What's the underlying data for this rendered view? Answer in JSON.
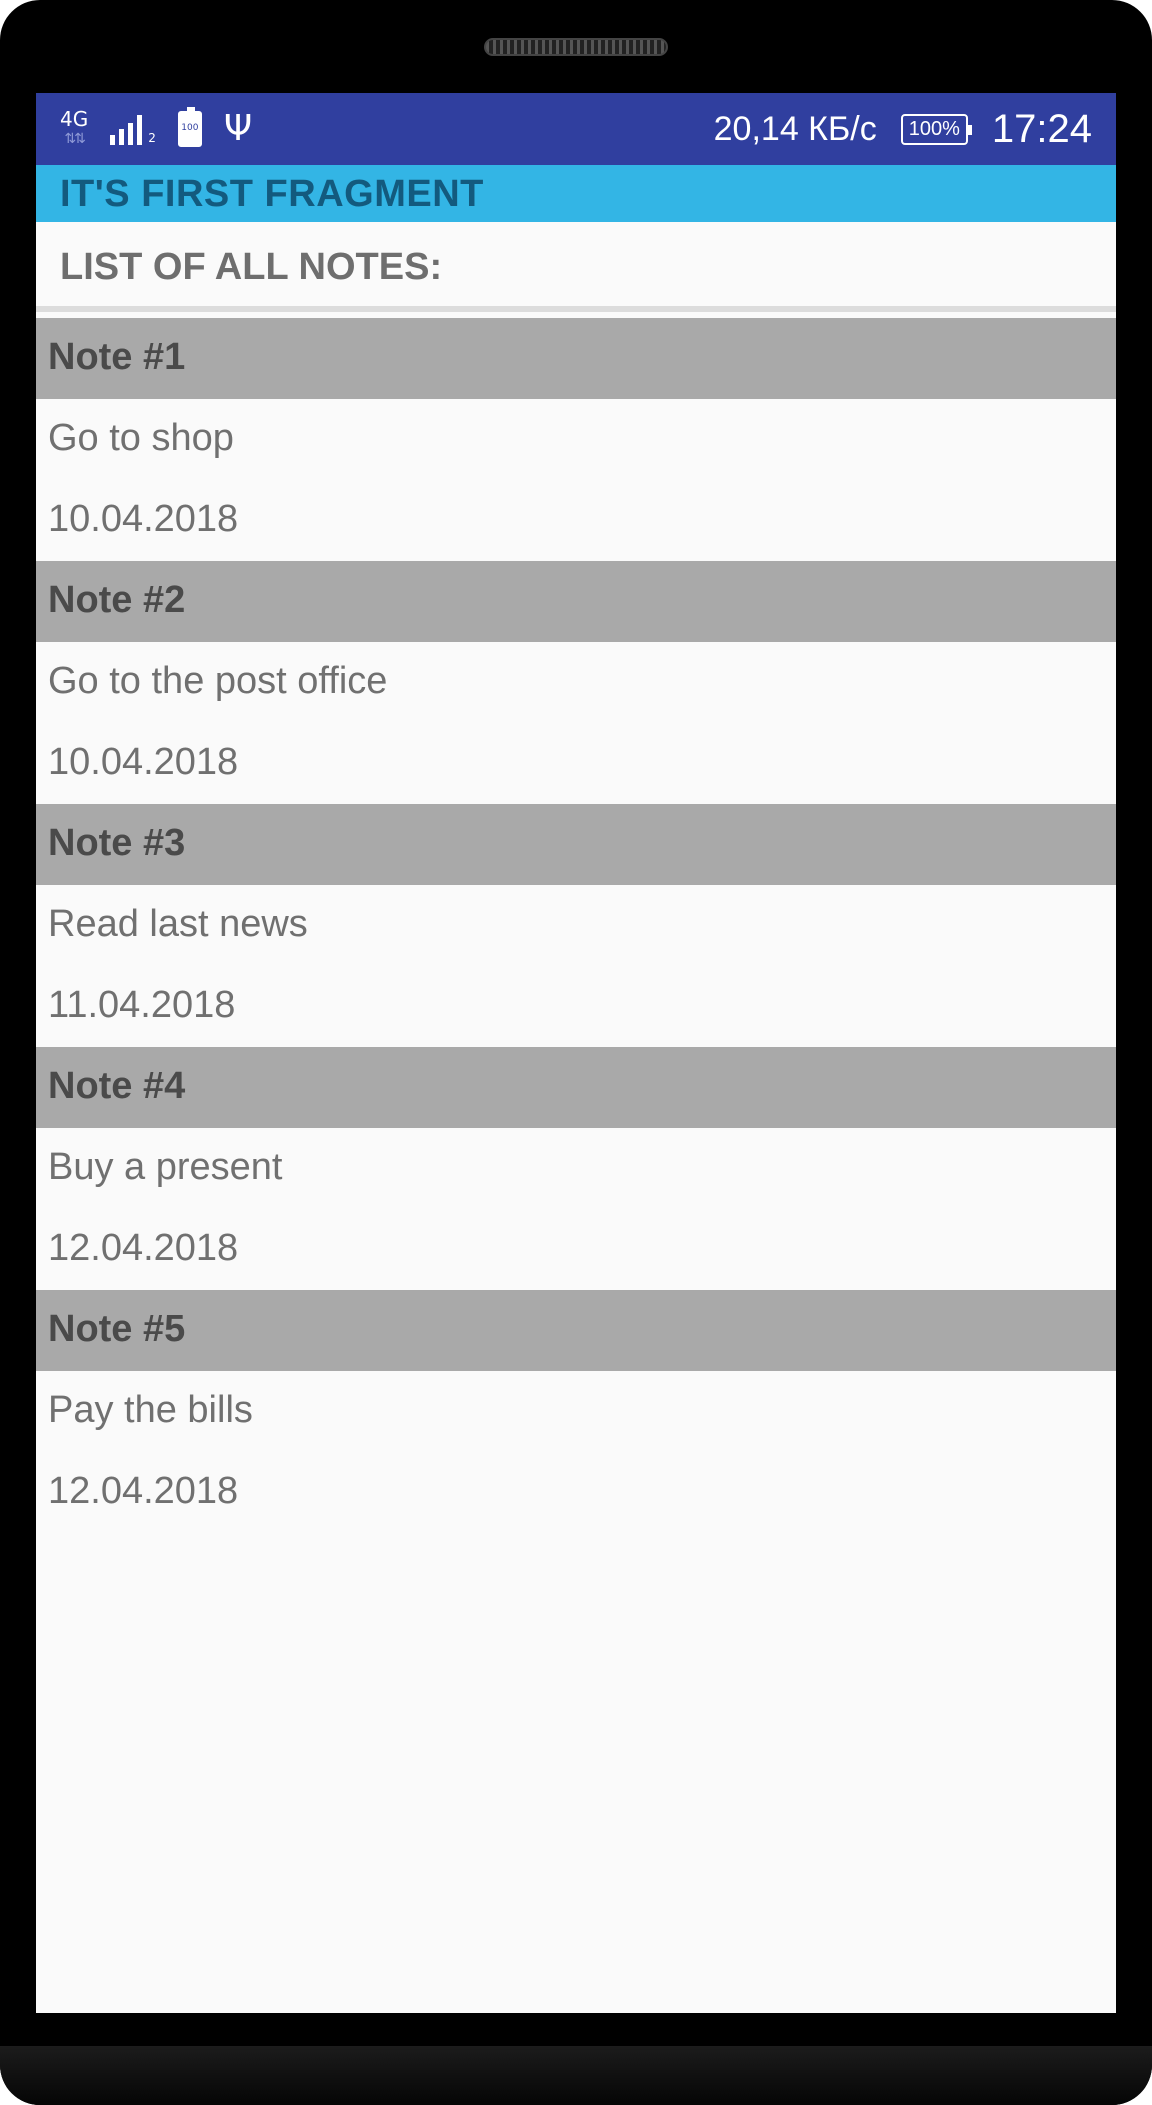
{
  "status_bar": {
    "network": "4G",
    "signal_sim": "2",
    "battery_icon_level": "100",
    "speed": "20,14 КБ/с",
    "battery_percent": "100%",
    "time": "17:24"
  },
  "app_bar": {
    "title": "IT'S FIRST FRAGMENT"
  },
  "list": {
    "header": "LIST OF ALL NOTES:",
    "notes": [
      {
        "title": "Note #1",
        "text": "Go to shop",
        "date": "10.04.2018"
      },
      {
        "title": "Note #2",
        "text": "Go to the post office",
        "date": "10.04.2018"
      },
      {
        "title": "Note #3",
        "text": "Read last news",
        "date": "11.04.2018"
      },
      {
        "title": "Note #4",
        "text": "Buy a present",
        "date": "12.04.2018"
      },
      {
        "title": "Note #5",
        "text": "Pay the bills",
        "date": "12.04.2018"
      }
    ]
  },
  "colors": {
    "status_bar": "#303f9f",
    "app_bar": "#33b5e5",
    "app_bar_text": "#135a7e",
    "note_header": "#a9a9a9",
    "background": "#fafafa"
  },
  "icons": [
    "network-4g-icon",
    "signal-icon",
    "battery-icon",
    "usb-icon"
  ]
}
